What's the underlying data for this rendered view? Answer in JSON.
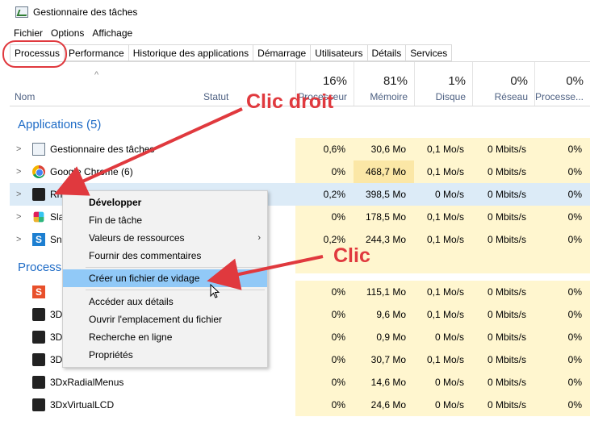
{
  "window": {
    "title": "Gestionnaire des tâches",
    "icon": "task-manager-icon"
  },
  "menu": [
    "Fichier",
    "Options",
    "Affichage"
  ],
  "tabs": [
    "Processus",
    "Performance",
    "Historique des applications",
    "Démarrage",
    "Utilisateurs",
    "Détails",
    "Services"
  ],
  "header": {
    "name": "Nom",
    "status": "Statut",
    "cols": [
      {
        "pct": "16%",
        "label": "Processeur"
      },
      {
        "pct": "81%",
        "label": "Mémoire"
      },
      {
        "pct": "1%",
        "label": "Disque"
      },
      {
        "pct": "0%",
        "label": "Réseau"
      },
      {
        "pct": "0%",
        "label": "Processe..."
      }
    ]
  },
  "groups": {
    "apps": "Applications (5)",
    "procs": "Process"
  },
  "apps": [
    {
      "name": "Gestionnaire des tâches",
      "proc": "0,6%",
      "mem": "30,6 Mo",
      "disk": "0,1 Mo/s",
      "net": "0 Mbits/s",
      "gpu": "0%",
      "icon": "task-manager-icon"
    },
    {
      "name": "Google Chrome (6)",
      "proc": "0%",
      "mem": "468,7 Mo",
      "disk": "0,1 Mo/s",
      "net": "0 Mbits/s",
      "gpu": "0%",
      "icon": "chrome-icon"
    },
    {
      "name": "Rh",
      "proc": "0,2%",
      "mem": "398,5 Mo",
      "disk": "0 Mo/s",
      "net": "0 Mbits/s",
      "gpu": "0%",
      "icon": "rhino-icon"
    },
    {
      "name": "Sla",
      "proc": "0%",
      "mem": "178,5 Mo",
      "disk": "0,1 Mo/s",
      "net": "0 Mbits/s",
      "gpu": "0%",
      "icon": "slack-icon"
    },
    {
      "name": "Sn",
      "proc": "0,2%",
      "mem": "244,3 Mo",
      "disk": "0,1 Mo/s",
      "net": "0 Mbits/s",
      "gpu": "0%",
      "icon": "snagit-icon"
    }
  ],
  "procs": [
    {
      "name": "",
      "proc": "0%",
      "mem": "115,1 Mo",
      "disk": "0,1 Mo/s",
      "net": "0 Mbits/s",
      "gpu": "0%",
      "icon": "snagit-red-icon"
    },
    {
      "name": "3D",
      "proc": "0%",
      "mem": "9,6 Mo",
      "disk": "0,1 Mo/s",
      "net": "0 Mbits/s",
      "gpu": "0%",
      "icon": "3dconnexion-icon"
    },
    {
      "name": "3D",
      "proc": "0%",
      "mem": "0,9 Mo",
      "disk": "0 Mo/s",
      "net": "0 Mbits/s",
      "gpu": "0%",
      "icon": "3dconnexion-icon"
    },
    {
      "name": "3D",
      "proc": "0%",
      "mem": "30,7 Mo",
      "disk": "0,1 Mo/s",
      "net": "0 Mbits/s",
      "gpu": "0%",
      "icon": "3dconnexion-icon"
    },
    {
      "name": "3DxRadialMenus",
      "proc": "0%",
      "mem": "14,6 Mo",
      "disk": "0 Mo/s",
      "net": "0 Mbits/s",
      "gpu": "0%",
      "icon": "3dconnexion-icon"
    },
    {
      "name": "3DxVirtualLCD",
      "proc": "0%",
      "mem": "24,6 Mo",
      "disk": "0 Mo/s",
      "net": "0 Mbits/s",
      "gpu": "0%",
      "icon": "3dconnexion-icon"
    }
  ],
  "context_menu": {
    "items": [
      "Développer",
      "Fin de tâche",
      "Valeurs de ressources",
      "Fournir des commentaires",
      "Créer un fichier de vidage",
      "Accéder aux détails",
      "Ouvrir l'emplacement du fichier",
      "Recherche en ligne",
      "Propriétés"
    ],
    "submenu_arrow": "›"
  },
  "annotations": {
    "right_click": "Clic droit",
    "click": "Clic",
    "color": "#e0393e"
  },
  "sort_indicator": "^"
}
